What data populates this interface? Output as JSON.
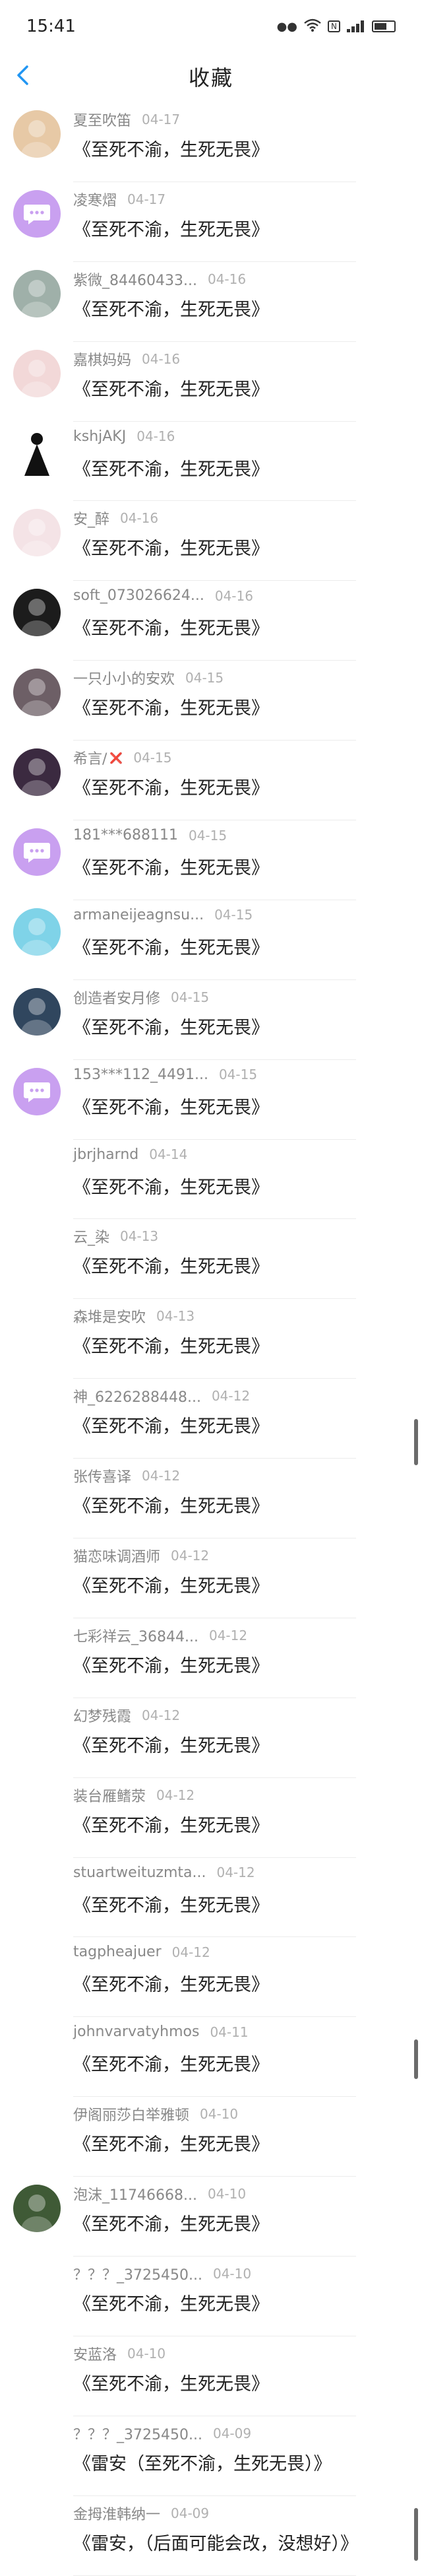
{
  "status_bar": {
    "time": "15:41",
    "indicators": [
      "notification-icon",
      "wifi-icon",
      "nfc-icon",
      "signal-icon",
      "battery-icon"
    ]
  },
  "header": {
    "title": "收藏",
    "back_icon": "chevron-left-icon"
  },
  "colors": {
    "accent": "#2196f3",
    "chat_avatar": "#c9a0f0",
    "red_mark": "#d62828"
  },
  "items": [
    {
      "name": "夏至吹笛",
      "date": "04-17",
      "comment": "《至死不渝，生死无畏》",
      "avatar": "photo",
      "bg": "#e7c9a6"
    },
    {
      "name": "凌寒熠",
      "date": "04-17",
      "comment": "《至死不渝，生死无畏》",
      "avatar": "chat",
      "bg": "#c9a0f0"
    },
    {
      "name": "紫微_84460433...",
      "date": "04-16",
      "comment": "《至死不渝，生死无畏》",
      "avatar": "photo",
      "bg": "#9fb0a9"
    },
    {
      "name": "嘉棋妈妈",
      "date": "04-16",
      "comment": "《至死不渝，生死无畏》",
      "avatar": "photo",
      "bg": "#f2d8d8"
    },
    {
      "name": "kshjAKJ",
      "date": "04-16",
      "comment": "《至死不渝，生死无畏》",
      "avatar": "silhouette",
      "bg": "#ffffff"
    },
    {
      "name": "安_醉",
      "date": "04-16",
      "comment": "《至死不渝，生死无畏》",
      "avatar": "photo",
      "bg": "#f4e3e6"
    },
    {
      "name": "soft_073026624...",
      "date": "04-16",
      "comment": "《至死不渝，生死无畏》",
      "avatar": "photo",
      "bg": "#1c1c1c"
    },
    {
      "name": "一只小小的安欢",
      "date": "04-15",
      "comment": "《至死不渝，生死无畏》",
      "avatar": "photo",
      "bg": "#6d5f66"
    },
    {
      "name": "希言/",
      "date": "04-15",
      "mark": "❌",
      "comment": "《至死不渝，生死无畏》",
      "avatar": "photo",
      "bg": "#3b2a40"
    },
    {
      "name": "181***688111",
      "date": "04-15",
      "comment": "《至死不渝，生死无畏》",
      "avatar": "chat",
      "bg": "#c9a0f0"
    },
    {
      "name": "armaneijeagnsu...",
      "date": "04-15",
      "comment": "《至死不渝，生死无畏》",
      "avatar": "photo",
      "bg": "#7fd3e8"
    },
    {
      "name": "创造者安月修",
      "date": "04-15",
      "comment": "《至死不渝，生死无畏》",
      "avatar": "photo",
      "bg": "#30465e"
    },
    {
      "name": "153***112_4491...",
      "date": "04-15",
      "comment": "《至死不渝，生死无畏》",
      "avatar": "chat",
      "bg": "#c9a0f0"
    },
    {
      "name": "jbrjharnd",
      "date": "04-14",
      "comment": "《至死不渝，生死无畏》",
      "avatar": "none"
    },
    {
      "name": "云_染",
      "date": "04-13",
      "comment": "《至死不渝，生死无畏》",
      "avatar": "none"
    },
    {
      "name": "森堆是安吹",
      "date": "04-13",
      "comment": "《至死不渝，生死无畏》",
      "avatar": "none"
    },
    {
      "name": "神_6226288448...",
      "date": "04-12",
      "comment": "《至死不渝，生死无畏》",
      "avatar": "none"
    },
    {
      "name": "张传喜译",
      "date": "04-12",
      "comment": "《至死不渝，生死无畏》",
      "avatar": "none"
    },
    {
      "name": "猫恋味调酒师",
      "date": "04-12",
      "comment": "《至死不渝，生死无畏》",
      "avatar": "none"
    },
    {
      "name": "七彩祥云_36844...",
      "date": "04-12",
      "comment": "《至死不渝，生死无畏》",
      "avatar": "none"
    },
    {
      "name": "幻梦残霞",
      "date": "04-12",
      "comment": "《至死不渝，生死无畏》",
      "avatar": "none"
    },
    {
      "name": "装台雁鳍荥",
      "date": "04-12",
      "comment": "《至死不渝，生死无畏》",
      "avatar": "none"
    },
    {
      "name": "stuartweituzmta...",
      "date": "04-12",
      "comment": "《至死不渝，生死无畏》",
      "avatar": "none"
    },
    {
      "name": "tagpheajuer",
      "date": "04-12",
      "comment": "《至死不渝，生死无畏》",
      "avatar": "none"
    },
    {
      "name": "johnvarvatyhmos",
      "date": "04-11",
      "comment": "《至死不渝，生死无畏》",
      "avatar": "none"
    },
    {
      "name": "伊阁丽莎白举雅顿",
      "date": "04-10",
      "comment": "《至死不渝，生死无畏》",
      "avatar": "none"
    },
    {
      "name": "泡沫_11746668...",
      "date": "04-10",
      "comment": "《至死不渝，生死无畏》",
      "avatar": "photo",
      "bg": "#3f5a36"
    },
    {
      "name": "？？？_3725450...",
      "date": "04-10",
      "comment": "《至死不渝，生死无畏》",
      "avatar": "none"
    },
    {
      "name": "安蓝洛",
      "date": "04-10",
      "comment": "《至死不渝，生死无畏》",
      "avatar": "none"
    },
    {
      "name": "？？？_3725450...",
      "date": "04-09",
      "comment": "《雷安（至死不渝，生死无畏）》",
      "avatar": "none"
    },
    {
      "name": "金拇淮韩纳一",
      "date": "04-09",
      "comment": "《雷安，（后面可能会改，没想好）》",
      "avatar": "none"
    }
  ]
}
